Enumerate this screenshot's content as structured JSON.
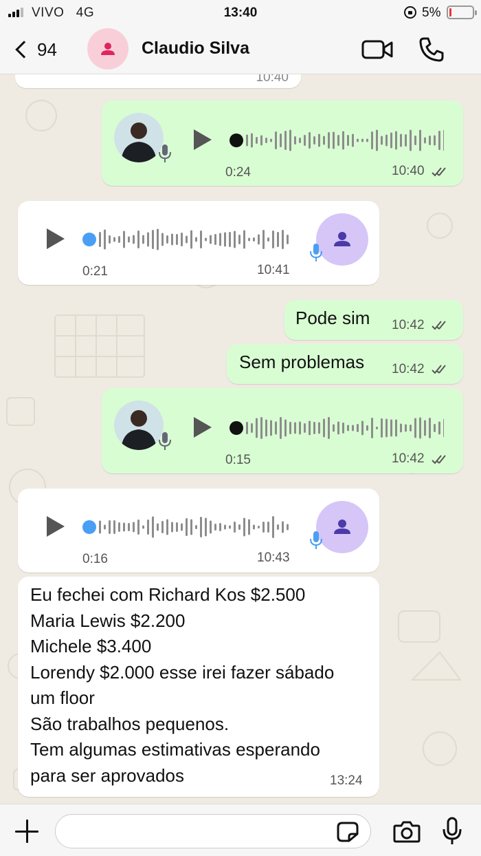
{
  "status_bar": {
    "carrier": "VIVO",
    "network": "4G",
    "time": "13:40",
    "battery": "5%"
  },
  "header": {
    "back_count": "94",
    "contact_name": "Claudio Silva"
  },
  "messages": [
    {
      "type": "voice",
      "direction": "outgoing",
      "duration": "0:24",
      "time": "10:40",
      "status": "read"
    },
    {
      "type": "voice",
      "direction": "incoming",
      "duration": "0:21",
      "time": "10:41"
    },
    {
      "type": "text",
      "direction": "outgoing",
      "text": "Pode sim",
      "time": "10:42",
      "status": "read"
    },
    {
      "type": "text",
      "direction": "outgoing",
      "text": "Sem problemas",
      "time": "10:42",
      "status": "read"
    },
    {
      "type": "voice",
      "direction": "outgoing",
      "duration": "0:15",
      "time": "10:42",
      "status": "read"
    },
    {
      "type": "voice",
      "direction": "incoming",
      "duration": "0:16",
      "time": "10:43"
    },
    {
      "type": "text",
      "direction": "incoming",
      "lines": [
        "Eu fechei com Richard Kos $2.500",
        "Maria Lewis $2.200",
        "Michele $3.400",
        "Lorendy $2.000 esse irei fazer sábado",
        "um floor",
        "São trabalhos pequenos.",
        "Tem algumas estimativas esperando",
        "para ser aprovados"
      ],
      "time": "13:24"
    }
  ],
  "previous_message": {
    "time": "10:40"
  },
  "input_bar": {
    "placeholder": ""
  },
  "colors": {
    "outgoing_bubble": "#d9fdd3",
    "incoming_bubble": "#ffffff",
    "background": "#efeae2",
    "accent_blue": "#4a9ff5"
  }
}
